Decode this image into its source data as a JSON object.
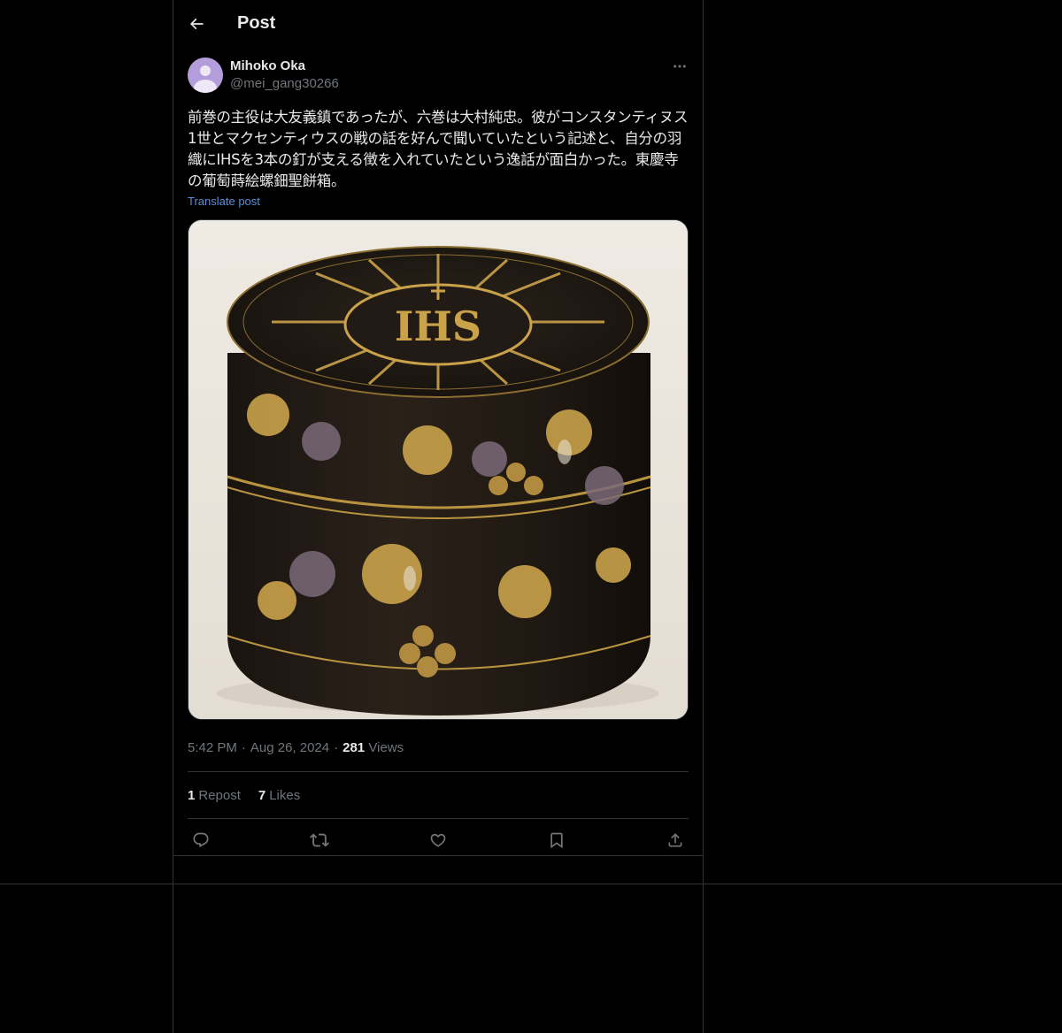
{
  "header": {
    "title": "Post"
  },
  "author": {
    "display_name": "Mihoko Oka",
    "handle": "@mei_gang30266"
  },
  "post": {
    "text": "前巻の主役は大友義鎮であったが、六巻は大村純忠。彼がコンスタンティヌス1世とマクセンティウスの戦の話を好んで聞いていたという記述と、自分の羽織にIHSを3本の釘が支える徴を入れていたという逸話が面白かった。東慶寺の葡萄蒔絵螺鈿聖餅箱。",
    "translate_label": "Translate post",
    "image_inscription": "IHS"
  },
  "meta": {
    "time": "5:42 PM",
    "separator": "·",
    "date": "Aug 26, 2024",
    "views_count": "281",
    "views_label": "Views"
  },
  "stats": {
    "reposts_count": "1",
    "reposts_label": "Repost",
    "likes_count": "7",
    "likes_label": "Likes"
  },
  "icons": {
    "back": "arrow-left-icon",
    "more": "more-horizontal-icon",
    "reply": "reply-icon",
    "repost": "repost-icon",
    "like": "heart-icon",
    "bookmark": "bookmark-icon",
    "share": "share-icon"
  },
  "colors": {
    "background": "#000000",
    "text": "#e7e9ea",
    "secondary": "#71767b",
    "link": "#5b8fd8",
    "border": "#2f3336"
  }
}
